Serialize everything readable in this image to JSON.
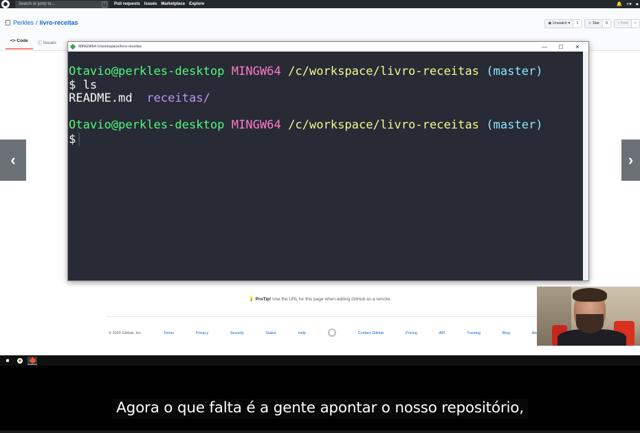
{
  "github": {
    "search_placeholder": "Search or jump to...",
    "search_shortcut": "/",
    "nav": [
      "Pull requests",
      "Issues",
      "Marketplace",
      "Explore"
    ],
    "repo_owner": "Perkles",
    "repo_separator": "/",
    "repo_name": "livro-receitas",
    "watch_label": "Unwatch",
    "watch_count": "1",
    "star_label": "Star",
    "star_count": "0",
    "fork_label": "Fork",
    "fork_count": "0",
    "tabs": [
      "Code",
      "Issues"
    ],
    "protip_label": "ProTip!",
    "protip_text": "Use the URL for this page when adding GitHub as a remote.",
    "footer_copyright": "© 2020 GitHub, Inc.",
    "footer_links_left": [
      "Terms",
      "Privacy",
      "Security",
      "Status",
      "Help"
    ],
    "footer_links_right": [
      "Contact GitHub",
      "Pricing",
      "API",
      "Training",
      "Blog",
      "About"
    ]
  },
  "terminal": {
    "title": "MINGW64:/c/workspace/livro-receitas",
    "controls": {
      "minimize": "—",
      "maximize": "☐",
      "close": "✕"
    },
    "lines": {
      "user1": "Otavio@perkles-desktop",
      "env1": "MINGW64",
      "path1": "/c/workspace/livro-receitas",
      "branch1": "(master)",
      "cmd1": "$ ls",
      "out_file": "README.md",
      "out_dir": "receitas/",
      "user2": "Otavio@perkles-desktop",
      "env2": "MINGW64",
      "path2": "/c/workspace/livro-receitas",
      "branch2": "(master)",
      "prompt2": "$"
    },
    "colors": {
      "background": "#282a36",
      "user": "#50fa7b",
      "env": "#ff79c6",
      "path": "#f1fa8c",
      "branch": "#8be9fd",
      "directory": "#bd93f9"
    }
  },
  "carousel": {
    "prev_icon": "‹",
    "next_icon": "›"
  },
  "subtitle": "Agora o que falta é a gente apontar o nosso repositório,"
}
